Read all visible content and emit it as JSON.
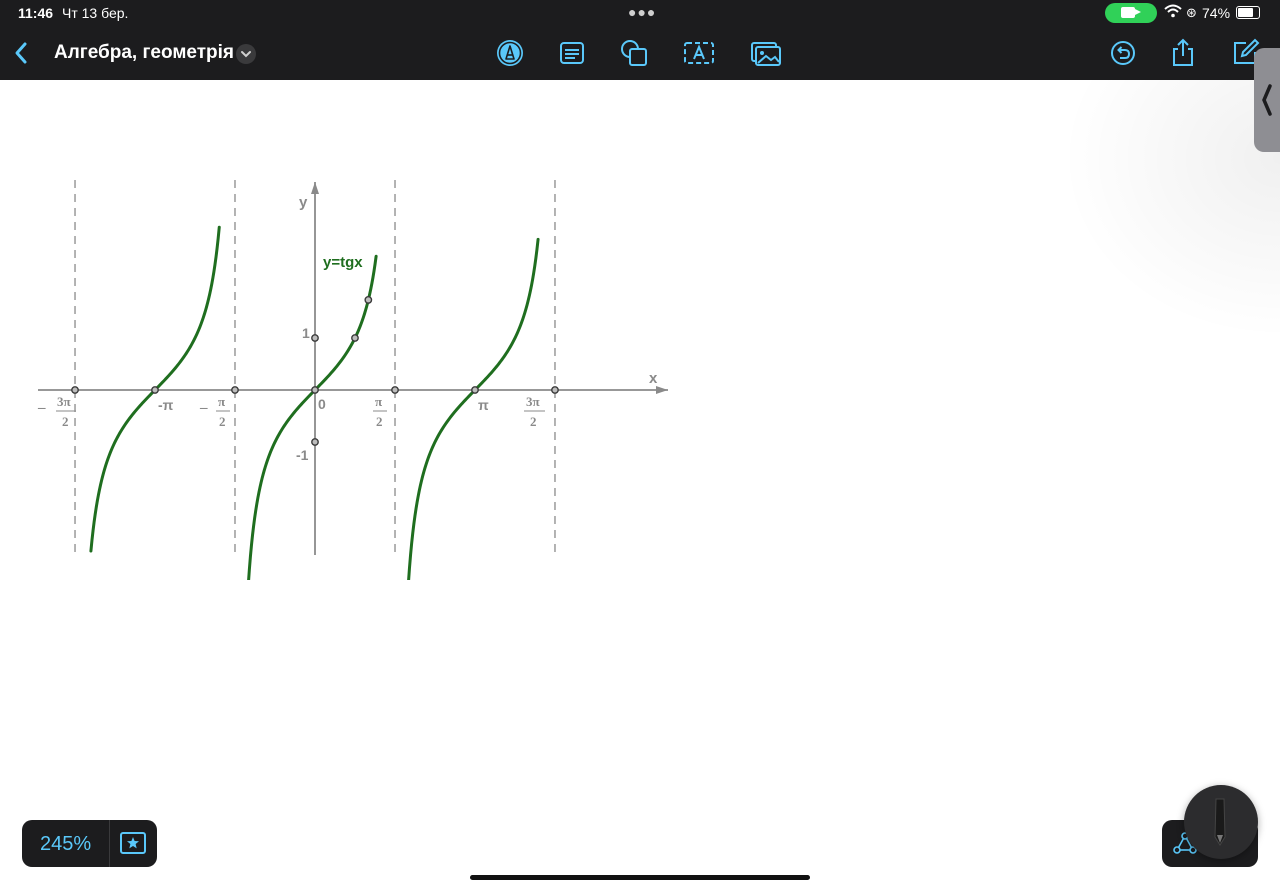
{
  "status": {
    "time": "11:46",
    "date": "Чт 13 бер.",
    "battery": "74%"
  },
  "toolbar": {
    "title": "Алгебра, геометрія",
    "icons": {
      "back": "chevron-left-icon",
      "menu": "chevron-down-icon",
      "pen": "pen-tool-icon",
      "text_box": "text-box-icon",
      "shapes": "shapes-icon",
      "text": "text-icon",
      "image": "image-icon",
      "undo": "undo-icon",
      "share": "share-icon",
      "edit": "compose-icon"
    },
    "accent_color": "#5ac8fa"
  },
  "graph": {
    "function_label": "y=tgx",
    "x_axis_label": "x",
    "y_axis_label": "y",
    "y_tick_labels": [
      "1",
      "-1"
    ],
    "origin_label": "0",
    "x_tick_labels": {
      "neg_pi": "-π",
      "pi": "π",
      "pi_symbol": "π",
      "two": "2",
      "minus": "–"
    },
    "curve_color": "#1f6e1f",
    "asymptotes_x": [
      -4.712,
      -1.571,
      1.571,
      4.712
    ],
    "branches": [
      {
        "x_from": -4.4,
        "x_to": -1.88
      },
      {
        "x_from": -1.31,
        "x_to": 1.2
      },
      {
        "x_from": 1.79,
        "x_to": 4.38
      }
    ],
    "marked_points": [
      {
        "x": -4.712,
        "y": 0
      },
      {
        "x": -3.1416,
        "y": 0
      },
      {
        "x": -1.571,
        "y": 0
      },
      {
        "x": 0,
        "y": 0
      },
      {
        "x": 1.571,
        "y": 0
      },
      {
        "x": 3.1416,
        "y": 0
      },
      {
        "x": 4.712,
        "y": 0
      },
      {
        "x": 0,
        "y": 1
      },
      {
        "x": 0,
        "y": -1
      },
      {
        "x": 0.785,
        "y": 1
      },
      {
        "x": 1.047,
        "y": 1.732
      }
    ]
  },
  "zoom": {
    "level": "245%"
  }
}
